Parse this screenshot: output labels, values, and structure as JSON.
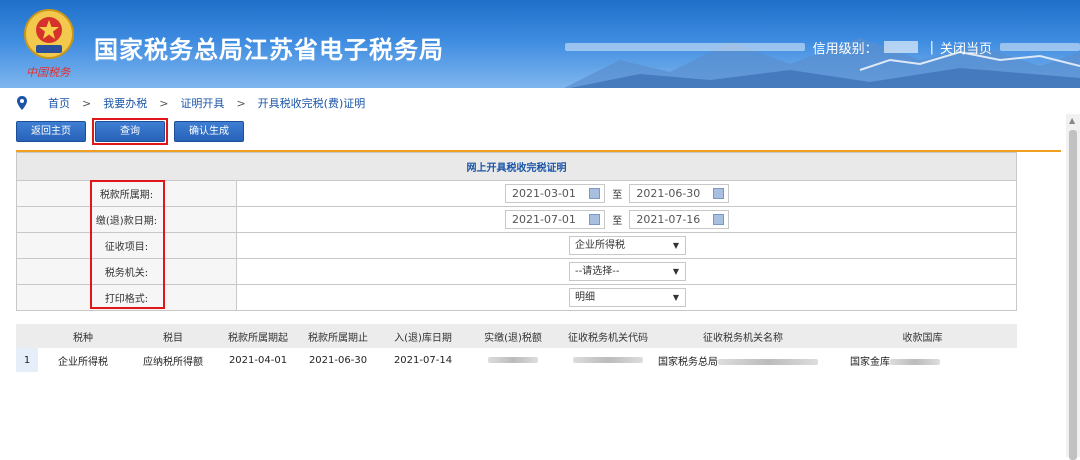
{
  "header": {
    "site_title": "国家税务总局江苏省电子税务局",
    "signature": "中国税务",
    "credit_label": "信用级别：",
    "close_label": "关闭当页",
    "sep": "|"
  },
  "breadcrumb": [
    "首页",
    "我要办税",
    "证明开具",
    "开具税收完税(费)证明"
  ],
  "toolbar": {
    "back_label": "返回主页",
    "query_label": "查询",
    "confirm_label": "确认生成"
  },
  "form": {
    "title": "网上开具税收完税证明",
    "tax_period_label": "税款所属期:",
    "tax_period_start": "2021-03-01",
    "tax_period_end": "2021-06-30",
    "pay_date_label": "缴(退)款日期:",
    "pay_date_start": "2021-07-01",
    "pay_date_end": "2021-07-16",
    "to_label": "至",
    "levy_item_label": "征收项目:",
    "levy_item_value": "企业所得税",
    "tax_office_label": "税务机关:",
    "tax_office_value": "--请选择--",
    "print_format_label": "打印格式:",
    "print_format_value": "明细"
  },
  "grid": {
    "headers": [
      "税种",
      "税目",
      "税款所属期起",
      "税款所属期止",
      "入(退)库日期",
      "实缴(退)税额",
      "征收税务机关代码",
      "征收税务机关名称",
      "收款国库"
    ],
    "rows": [
      {
        "index": "1",
        "tax_type": "企业所得税",
        "tax_item": "应纳税所得额",
        "period_start": "2021-04-01",
        "period_end": "2021-06-30",
        "storage_date": "2021-07-14",
        "office_name_prefix": "国家税务总局",
        "treasury_prefix": "国家金库"
      }
    ]
  }
}
